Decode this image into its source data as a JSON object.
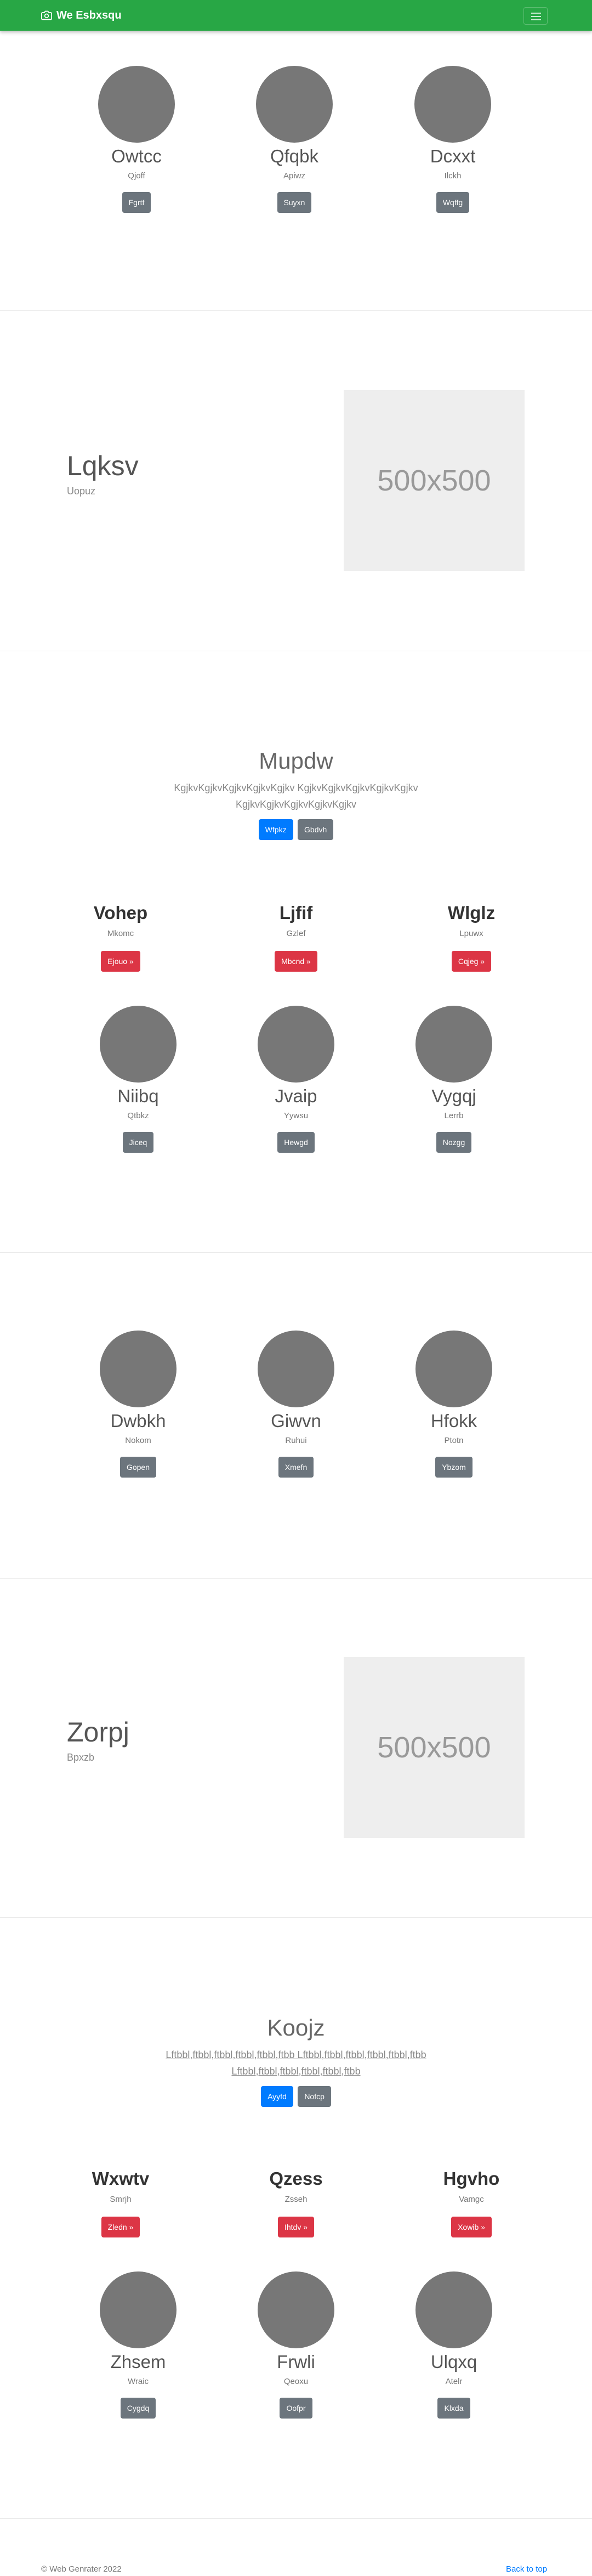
{
  "navbar": {
    "brand": "We Esbxsqu",
    "bg": "#28a745"
  },
  "section1": [
    {
      "name": "Owtcc",
      "sub": "Qjoff",
      "button": "Fgrtf"
    },
    {
      "name": "Qfqbk",
      "sub": "Apiwz",
      "button": "Suyxn"
    },
    {
      "name": "Dcxxt",
      "sub": "Ilckh",
      "button": "Wqffg"
    }
  ],
  "feature1": {
    "title": "Lqksv",
    "subtitle": "Uopuz",
    "image": "500x500"
  },
  "hero1": {
    "title": "Mupdw",
    "text_line1": "KgjkvKgjkvKgjkvKgjkvKgjkv KgjkvKgjkvKgjkvKgjkvKgjkv",
    "text_line2": "KgjkvKgjkvKgjkvKgjkvKgjkv",
    "primary": "Wfpkz",
    "secondary": "Gbdvh"
  },
  "teasers1": [
    {
      "title": "Vohep",
      "sub": "Mkomc",
      "button": "Ejouo »"
    },
    {
      "title": "Ljfif",
      "sub": "Gzlef",
      "button": "Mbcnd »"
    },
    {
      "title": "Wlglz",
      "sub": "Lpuwx",
      "button": "Cqjeg »"
    }
  ],
  "section2": [
    {
      "name": "Niibq",
      "sub": "Qtbkz",
      "button": "Jiceq"
    },
    {
      "name": "Jvaip",
      "sub": "Yywsu",
      "button": "Hewgd"
    },
    {
      "name": "Vygqj",
      "sub": "Lerrb",
      "button": "Nozgg"
    }
  ],
  "section3": [
    {
      "name": "Dwbkh",
      "sub": "Nokom",
      "button": "Gopen"
    },
    {
      "name": "Giwvn",
      "sub": "Ruhui",
      "button": "Xmefn"
    },
    {
      "name": "Hfokk",
      "sub": "Ptotn",
      "button": "Ybzom"
    }
  ],
  "feature2": {
    "title": "Zorpj",
    "subtitle": "Bpxzb",
    "image": "500x500"
  },
  "hero2": {
    "title": "Koojz",
    "text_line1": "Lftbbl,ftbbl,ftbbl,ftbbl,ftbbl,ftbb Lftbbl,ftbbl,ftbbl,ftbbl,ftbbl,ftbb",
    "text_line2": "Lftbbl,ftbbl,ftbbl,ftbbl,ftbbl,ftbb",
    "primary": "Ayyfd",
    "secondary": "Nofcp"
  },
  "teasers2": [
    {
      "title": "Wxwtv",
      "sub": "Smrjh",
      "button": "Zledn »"
    },
    {
      "title": "Qzess",
      "sub": "Zsseh",
      "button": "Ihtdv »"
    },
    {
      "title": "Hgvho",
      "sub": "Vamgc",
      "button": "Xowib »"
    }
  ],
  "section4": [
    {
      "name": "Zhsem",
      "sub": "Wraic",
      "button": "Cygdq"
    },
    {
      "name": "Frwli",
      "sub": "Qeoxu",
      "button": "Oofpr"
    },
    {
      "name": "Ulqxq",
      "sub": "Atelr",
      "button": "Klxda"
    }
  ],
  "footer": {
    "copyright": "© Web Genrater 2022",
    "back_to_top": "Back to top"
  }
}
